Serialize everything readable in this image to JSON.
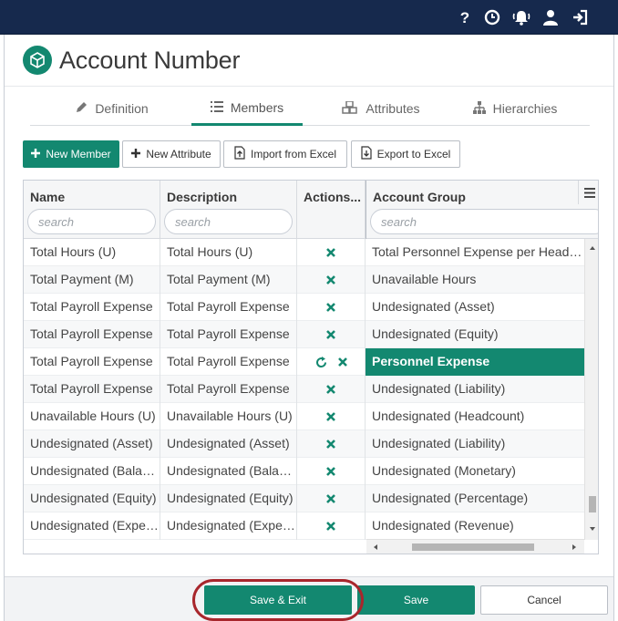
{
  "colors": {
    "topbar": "#16294d",
    "accent": "#138870",
    "annotation_ring": "#a8262c"
  },
  "topbar": {
    "icons": [
      "help-icon",
      "history-icon",
      "notifications-icon",
      "user-icon",
      "logout-icon"
    ]
  },
  "header": {
    "title": "Account Number",
    "logo_icon": "dimension-cube-icon"
  },
  "tabs": [
    {
      "label": "Definition",
      "icon": "pencil-icon",
      "active": false
    },
    {
      "label": "Members",
      "icon": "list-icon",
      "active": true
    },
    {
      "label": "Attributes",
      "icon": "cubes-icon",
      "active": false
    },
    {
      "label": "Hierarchies",
      "icon": "sitemap-icon",
      "active": false
    }
  ],
  "toolbar": {
    "new_member": "New Member",
    "new_attribute": "New Attribute",
    "import_excel": "Import from Excel",
    "export_excel": "Export to Excel"
  },
  "grid": {
    "columns": [
      "Name",
      "Description",
      "Actions...",
      "Account Group"
    ],
    "search_placeholder": "search",
    "rows": [
      {
        "name": "Total Hours (U)",
        "description": "Total Hours (U)",
        "actions": [
          "delete"
        ],
        "group": "Total Personnel Expense per Headcount"
      },
      {
        "name": "Total Payment (M)",
        "description": "Total Payment (M)",
        "actions": [
          "delete"
        ],
        "group": "Unavailable Hours"
      },
      {
        "name": "Total Payroll Expense",
        "description": "Total Payroll Expense",
        "actions": [
          "delete"
        ],
        "group": "Undesignated (Asset)"
      },
      {
        "name": "Total Payroll Expense",
        "description": "Total Payroll Expense",
        "actions": [
          "delete"
        ],
        "group": "Undesignated (Equity)"
      },
      {
        "name": "Total Payroll Expense",
        "description": "Total Payroll Expense",
        "actions": [
          "undo",
          "delete"
        ],
        "group": "Personnel Expense",
        "selected": true
      },
      {
        "name": "Total Payroll Expense",
        "description": "Total Payroll Expense",
        "actions": [
          "delete"
        ],
        "group": "Undesignated (Liability)"
      },
      {
        "name": "Unavailable Hours (U)",
        "description": "Unavailable Hours (U)",
        "actions": [
          "delete"
        ],
        "group": "Undesignated (Headcount)"
      },
      {
        "name": "Undesignated (Asset)",
        "description": "Undesignated (Asset)",
        "actions": [
          "delete"
        ],
        "group": "Undesignated (Liability)"
      },
      {
        "name": "Undesignated (Balance)",
        "description": "Undesignated (Balance)",
        "actions": [
          "delete"
        ],
        "group": "Undesignated (Monetary)"
      },
      {
        "name": "Undesignated (Equity)",
        "description": "Undesignated (Equity)",
        "actions": [
          "delete"
        ],
        "group": "Undesignated (Percentage)"
      },
      {
        "name": "Undesignated (Expense)",
        "description": "Undesignated (Expense)",
        "actions": [
          "delete"
        ],
        "group": "Undesignated (Revenue)"
      }
    ]
  },
  "footer": {
    "save_exit": "Save & Exit",
    "save": "Save",
    "cancel": "Cancel"
  }
}
